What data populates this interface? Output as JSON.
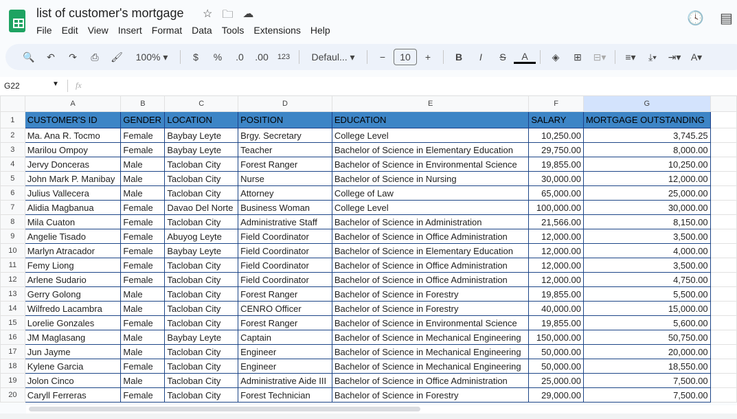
{
  "app": {
    "title": "list of customer's mortgage",
    "menu": [
      "File",
      "Edit",
      "View",
      "Insert",
      "Format",
      "Data",
      "Tools",
      "Extensions",
      "Help"
    ]
  },
  "toolbar": {
    "zoom": "100%",
    "currency": "$",
    "percent": "%",
    "dec_less": ".0",
    "dec_more": ".00",
    "format_num": "123",
    "font": "Defaul...",
    "font_size": "10",
    "bold": "B",
    "italic": "I",
    "text_color": "A"
  },
  "formula_bar": {
    "cell_ref": "G22",
    "fx": "fx",
    "value": ""
  },
  "columns": [
    "A",
    "B",
    "C",
    "D",
    "E",
    "F",
    "G"
  ],
  "header": [
    "CUSTOMER'S ID",
    "GENDER",
    "LOCATION",
    "POSITION",
    "EDUCATION",
    "SALARY",
    "MORTGAGE OUTSTANDING"
  ],
  "rows": [
    [
      "Ma. Ana R. Tocmo",
      "Female",
      "Baybay Leyte",
      "Brgy. Secretary",
      "College Level",
      "10,250.00",
      "3,745.25"
    ],
    [
      "Marilou Ompoy",
      "Female",
      "Baybay Leyte",
      "Teacher",
      "Bachelor of Science in Elementary Education",
      "29,750.00",
      "8,000.00"
    ],
    [
      "Jervy Donceras",
      "Male",
      "Tacloban City",
      "Forest Ranger",
      "Bachelor of Science in Environmental Science",
      "19,855.00",
      "10,250.00"
    ],
    [
      "John Mark P. Manibay",
      "Male",
      "Tacloban City",
      "Nurse",
      "Bachelor of Science in Nursing",
      "30,000.00",
      "12,000.00"
    ],
    [
      "Julius Vallecera",
      "Male",
      "Tacloban City",
      "Attorney",
      "College of Law",
      "65,000.00",
      "25,000.00"
    ],
    [
      "Alidia Magbanua",
      "Female",
      "Davao Del Norte",
      "Business Woman",
      "College Level",
      "100,000.00",
      "30,000.00"
    ],
    [
      "Mila Cuaton",
      "Female",
      "Tacloban City",
      "Administrative Staff",
      "Bachelor of Science in Administration",
      "21,566.00",
      "8,150.00"
    ],
    [
      "Angelie Tisado",
      "Female",
      "Abuyog Leyte",
      "Field Coordinator",
      "Bachelor of Science in Office Administration",
      "12,000.00",
      "3,500.00"
    ],
    [
      "Marlyn Atracador",
      "Female",
      "Baybay Leyte",
      "Field Coordinator",
      "Bachelor of Science in Elementary Education",
      "12,000.00",
      "4,000.00"
    ],
    [
      "Femy Liong",
      "Female",
      "Tacloban City",
      "Field Coordinator",
      "Bachelor of Science in Office Administration",
      "12,000.00",
      "3,500.00"
    ],
    [
      "Arlene Sudario",
      "Female",
      "Tacloban City",
      "Field Coordinator",
      "Bachelor of Science in Office Administration",
      "12,000.00",
      "4,750.00"
    ],
    [
      "Gerry Golong",
      "Male",
      "Tacloban City",
      "Forest Ranger",
      "Bachelor of Science in Forestry",
      "19,855.00",
      "5,500.00"
    ],
    [
      "Wilfredo Lacambra",
      "Male",
      "Tacloban City",
      "CENRO Officer",
      "Bachelor of Science in Forestry",
      "40,000.00",
      "15,000.00"
    ],
    [
      "Lorelie Gonzales",
      "Female",
      "Tacloban City",
      "Forest Ranger",
      "Bachelor of Science in Environmental Science",
      "19,855.00",
      "5,600.00"
    ],
    [
      "JM Maglasang",
      "Male",
      "Baybay Leyte",
      "Captain",
      "Bachelor of Science in Mechanical Engineering",
      "150,000.00",
      "50,750.00"
    ],
    [
      "Jun Jayme",
      "Male",
      "Tacloban City",
      "Engineer",
      "Bachelor of Science in Mechanical Engineering",
      "50,000.00",
      "20,000.00"
    ],
    [
      "Kylene Garcia",
      "Female",
      "Tacloban City",
      "Engineer",
      "Bachelor of Science in Mechanical Engineering",
      "50,000.00",
      "18,550.00"
    ],
    [
      "Jolon Cinco",
      "Male",
      "Tacloban City",
      "Administrative Aide III",
      "Bachelor of Science in Office Administration",
      "25,000.00",
      "7,500.00"
    ],
    [
      "Caryll Ferreras",
      "Female",
      "Tacloban City",
      "Forest Technician",
      "Bachelor of Science in Forestry",
      "29,000.00",
      "7,500.00"
    ]
  ]
}
